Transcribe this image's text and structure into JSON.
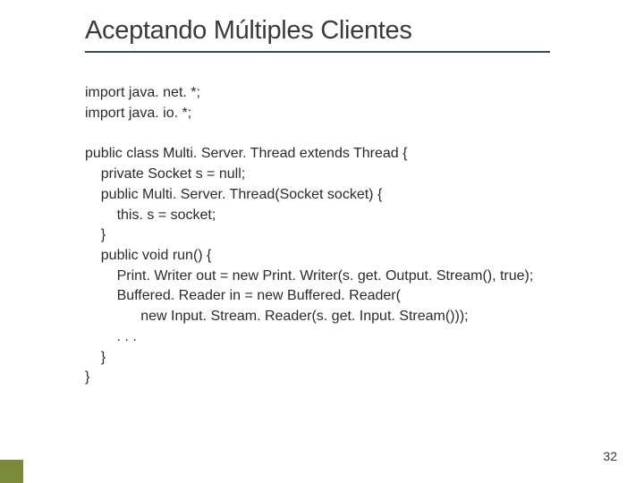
{
  "slide": {
    "title": "Aceptando Múltiples Clientes",
    "code_lines": [
      "import java. net. *;",
      "import java. io. *;",
      "",
      "public class Multi. Server. Thread extends Thread {",
      "    private Socket s = null;",
      "    public Multi. Server. Thread(Socket socket) {",
      "        this. s = socket;",
      "    }",
      "    public void run() {",
      "        Print. Writer out = new Print. Writer(s. get. Output. Stream(), true);",
      "        Buffered. Reader in = new Buffered. Reader(",
      "              new Input. Stream. Reader(s. get. Input. Stream()));",
      "        . . .",
      "    }",
      "}"
    ],
    "page_number": "32"
  }
}
